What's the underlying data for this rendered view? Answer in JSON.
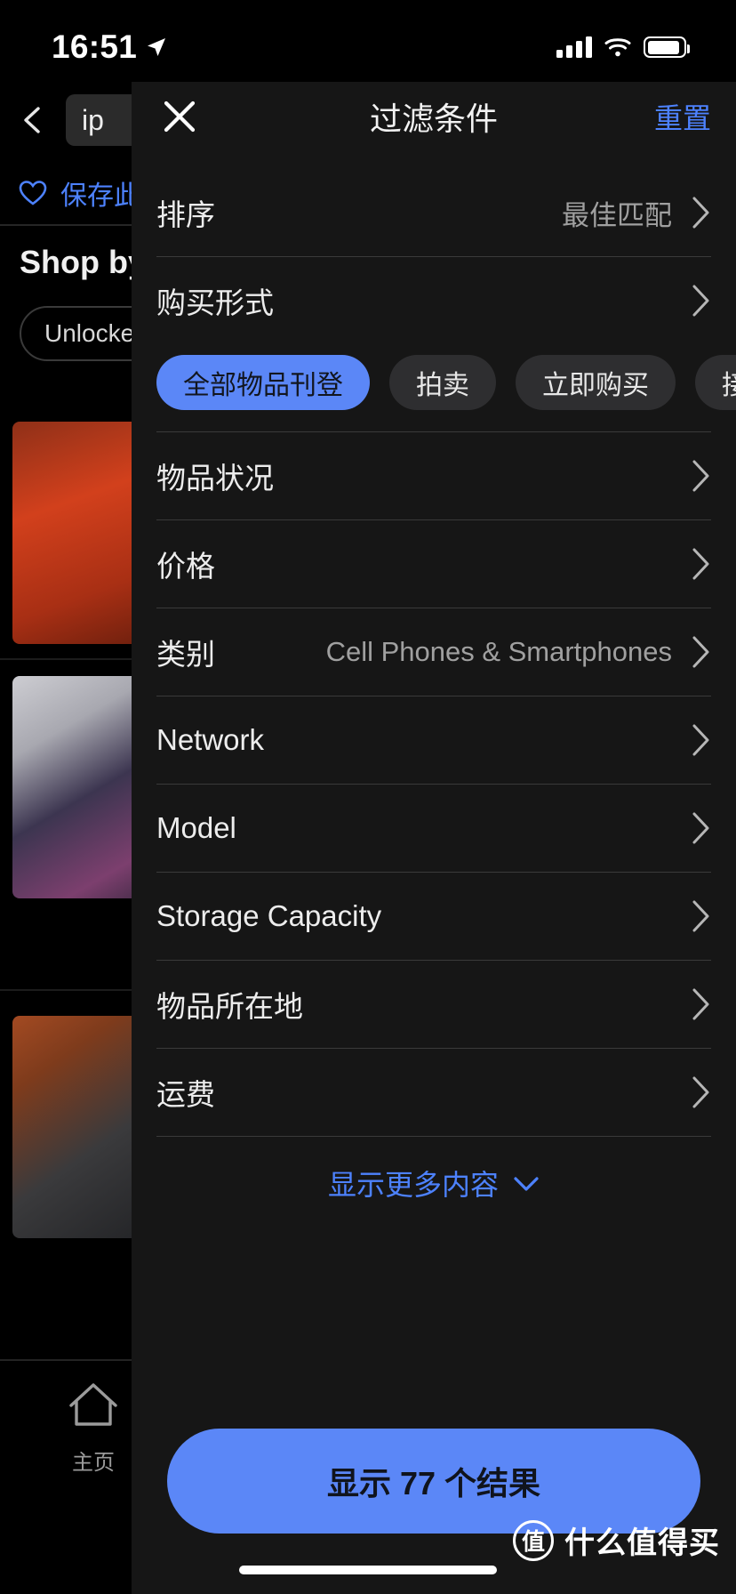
{
  "status_bar": {
    "time": "16:51",
    "location_icon": "location-arrow-icon",
    "signal_icon": "cellular-signal-icon",
    "wifi_icon": "wifi-icon",
    "battery_icon": "battery-icon"
  },
  "background_page": {
    "back_icon": "back-chevron-icon",
    "search_chip": "ip",
    "heart_icon": "heart-outline-icon",
    "save_search_label": "保存此搜索",
    "shop_by_label": "Shop by",
    "unlocked_chip": "Unlocked",
    "tab_home_icon": "home-icon",
    "tab_home_label": "主页"
  },
  "sheet": {
    "close_icon": "close-x-icon",
    "title": "过滤条件",
    "reset_label": "重置",
    "chevron_icon": "chevron-right-icon",
    "rows": [
      {
        "label": "排序",
        "value": "最佳匹配"
      },
      {
        "label": "购买形式",
        "value": ""
      },
      {
        "label": "物品状况",
        "value": ""
      },
      {
        "label": "价格",
        "value": ""
      },
      {
        "label": "类别",
        "value": "Cell Phones & Smartphones"
      },
      {
        "label": "Network",
        "value": ""
      },
      {
        "label": "Model",
        "value": ""
      },
      {
        "label": "Storage Capacity",
        "value": ""
      },
      {
        "label": "物品所在地",
        "value": ""
      },
      {
        "label": "运费",
        "value": ""
      }
    ],
    "buying_format_chips": [
      {
        "label": "全部物品刊登",
        "selected": true
      },
      {
        "label": "拍卖",
        "selected": false
      },
      {
        "label": "立即购买",
        "selected": false
      },
      {
        "label": "接受议价",
        "selected": false
      }
    ],
    "show_more_label": "显示更多内容",
    "show_more_icon": "chevron-down-icon",
    "tail_text": "运费",
    "cta_label": "显示 77 个结果",
    "result_count": "77"
  },
  "watermark": {
    "logo_char": "值",
    "text": "什么值得买"
  },
  "colors": {
    "accent_blue": "#5b87f7",
    "link_blue": "#4d82ff",
    "sheet_bg": "#161616",
    "page_bg": "#000000",
    "chip_bg": "#2e2e30",
    "divider": "#3a3a3a"
  }
}
